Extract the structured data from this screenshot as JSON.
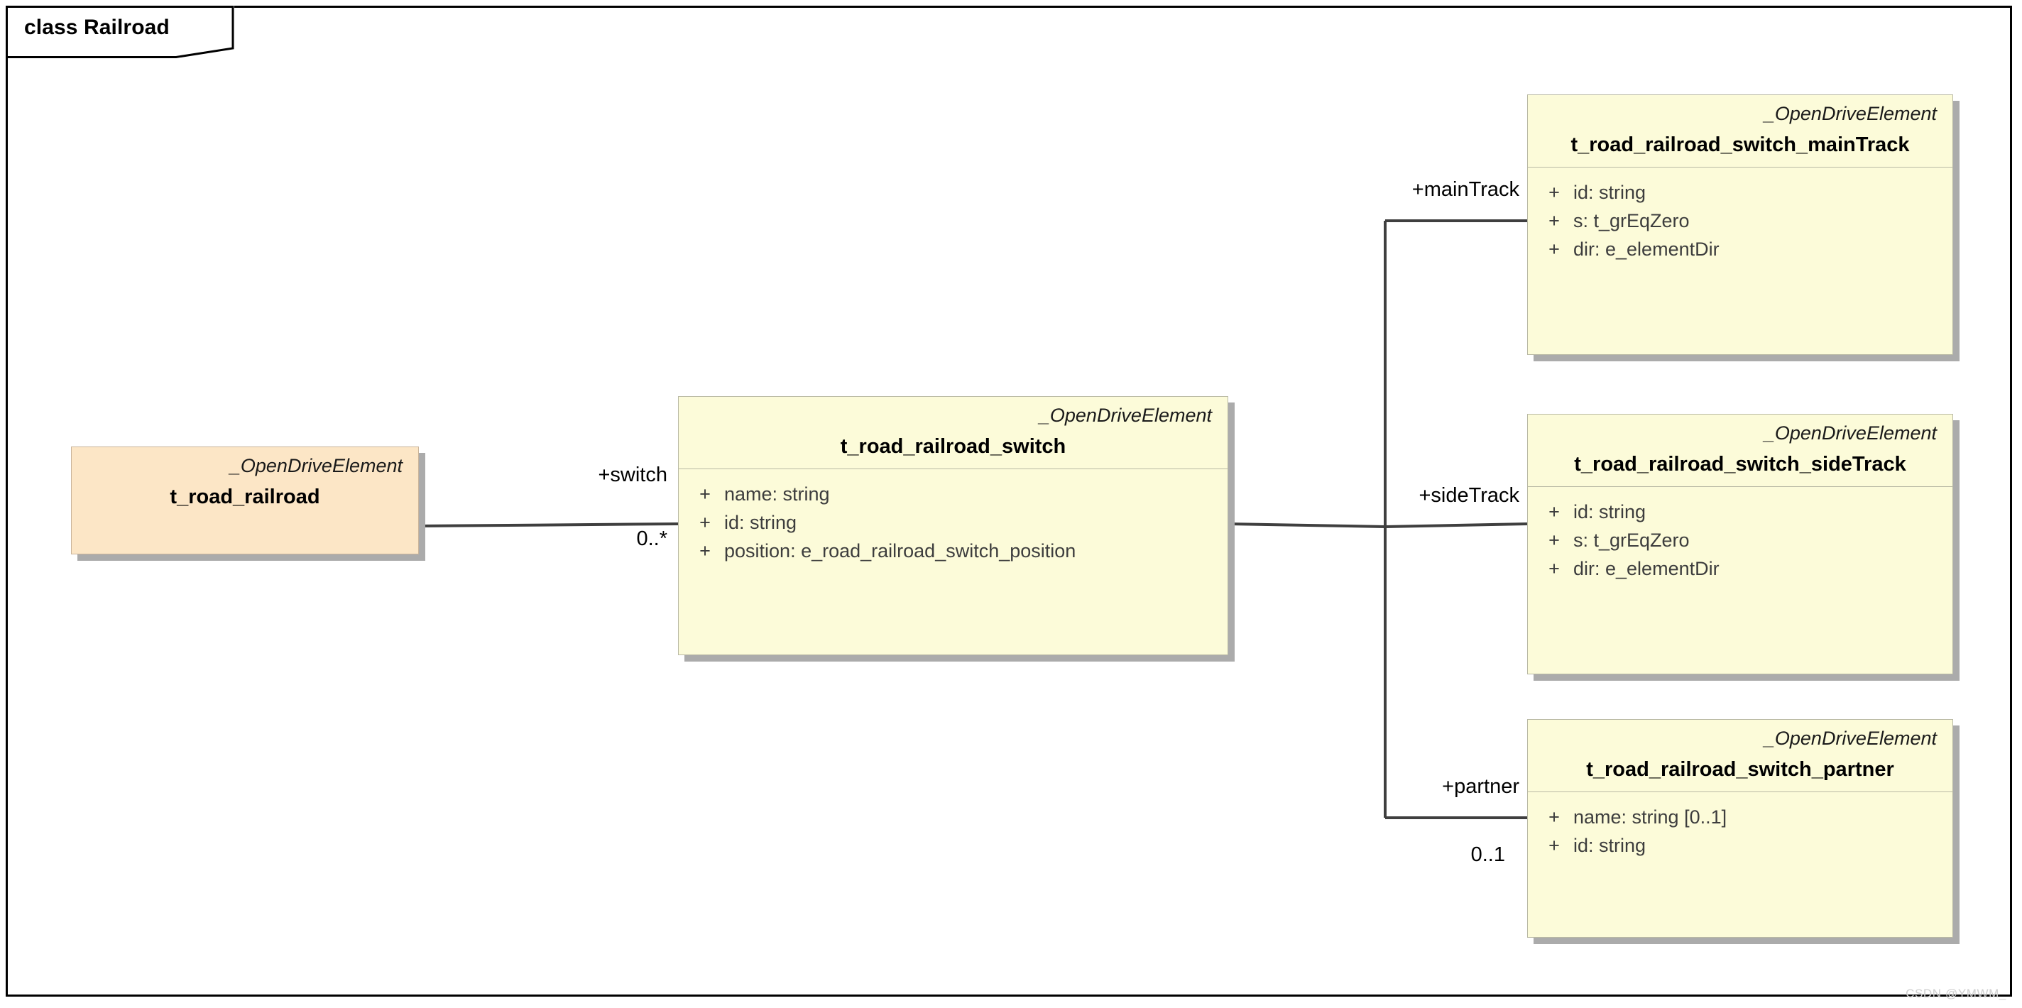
{
  "diagram": {
    "title": "class Railroad",
    "watermark": "CSDN @YMWM_",
    "colors": {
      "class_fill": "#fcfbd9",
      "root_fill": "#fce6c6",
      "border": "#b9b9a4",
      "shadow": "#ababab",
      "connector": "#3f3f3f",
      "frame": "#000000"
    }
  },
  "classes": [
    {
      "id": "t_road_railroad",
      "stereotype": "_OpenDriveElement",
      "name": "t_road_railroad",
      "attributes": []
    },
    {
      "id": "t_road_railroad_switch",
      "stereotype": "_OpenDriveElement",
      "name": "t_road_railroad_switch",
      "attributes": [
        {
          "visibility": "+",
          "text": "name: string"
        },
        {
          "visibility": "+",
          "text": "id: string"
        },
        {
          "visibility": "+",
          "text": "position: e_road_railroad_switch_position"
        }
      ]
    },
    {
      "id": "t_road_railroad_switch_mainTrack",
      "stereotype": "_OpenDriveElement",
      "name": "t_road_railroad_switch_mainTrack",
      "attributes": [
        {
          "visibility": "+",
          "text": "id: string"
        },
        {
          "visibility": "+",
          "text": "s: t_grEqZero"
        },
        {
          "visibility": "+",
          "text": "dir: e_elementDir"
        }
      ]
    },
    {
      "id": "t_road_railroad_switch_sideTrack",
      "stereotype": "_OpenDriveElement",
      "name": "t_road_railroad_switch_sideTrack",
      "attributes": [
        {
          "visibility": "+",
          "text": "id: string"
        },
        {
          "visibility": "+",
          "text": "s: t_grEqZero"
        },
        {
          "visibility": "+",
          "text": "dir: e_elementDir"
        }
      ]
    },
    {
      "id": "t_road_railroad_switch_partner",
      "stereotype": "_OpenDriveElement",
      "name": "t_road_railroad_switch_partner",
      "attributes": [
        {
          "visibility": "+",
          "text": "name: string [0..1]"
        },
        {
          "visibility": "+",
          "text": "id: string"
        }
      ]
    }
  ],
  "associations": [
    {
      "from": "t_road_railroad",
      "to": "t_road_railroad_switch",
      "role": "+switch",
      "multiplicity": "0..*"
    },
    {
      "from": "t_road_railroad_switch",
      "to": "t_road_railroad_switch_mainTrack",
      "role": "+mainTrack",
      "multiplicity": ""
    },
    {
      "from": "t_road_railroad_switch",
      "to": "t_road_railroad_switch_sideTrack",
      "role": "+sideTrack",
      "multiplicity": ""
    },
    {
      "from": "t_road_railroad_switch",
      "to": "t_road_railroad_switch_partner",
      "role": "+partner",
      "multiplicity": "0..1"
    }
  ]
}
